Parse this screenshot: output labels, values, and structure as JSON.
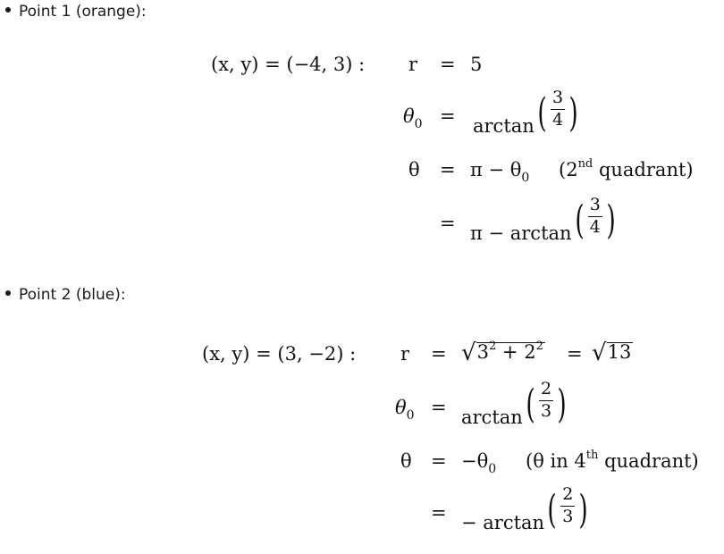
{
  "point1": {
    "label": "Point 1 (orange):",
    "lhs": "(x, y) = (−4, 3) :",
    "r_lhs": "r",
    "r_rhs": "5",
    "theta0_lhs": "θ",
    "theta0_sub": "0",
    "theta0_func": "arctan",
    "theta0_num": "3",
    "theta0_den": "4",
    "theta_lhs": "θ",
    "theta_rhs_main": "π − θ",
    "theta_rhs_sub": "0",
    "theta_note_open": "(2",
    "theta_note_sup": "nd",
    "theta_note_rest": "quadrant)",
    "final_rhs": "π − arctan",
    "final_num": "3",
    "final_den": "4"
  },
  "point2": {
    "label": "Point 2 (blue):",
    "lhs": "(x, y) = (3, −2) :",
    "r_lhs": "r",
    "r_sqrt_a": "3",
    "r_sqrt_a_sup": "2",
    "r_sqrt_plus": "+ 2",
    "r_sqrt_b_sup": "2",
    "r_eq2": "=",
    "r_result": "13",
    "theta0_lhs": "θ",
    "theta0_sub": "0",
    "theta0_func": "arctan",
    "theta0_num": "2",
    "theta0_den": "3",
    "theta_lhs": "θ",
    "theta_rhs_main": "−θ",
    "theta_rhs_sub": "0",
    "theta_note_open": "(θ in 4",
    "theta_note_sup": "th",
    "theta_note_rest": "quadrant)",
    "final_rhs": "− arctan",
    "final_num": "2",
    "final_den": "3"
  },
  "equals": "="
}
